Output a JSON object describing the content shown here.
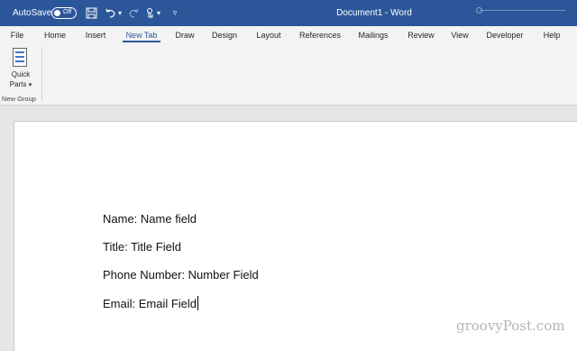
{
  "title_bar": {
    "autosave_label": "AutoSave",
    "autosave_state": "Off",
    "save_icon": "save-icon",
    "undo_icon": "undo-icon",
    "redo_icon": "redo-icon",
    "touch_icon": "touch-mode-icon",
    "customize_icon": "customize-qat-icon",
    "document_title": "Document1 - Word",
    "colors": {
      "background": "#2b579a",
      "text": "#ffffff"
    }
  },
  "tabs": [
    {
      "label": "File"
    },
    {
      "label": "Home"
    },
    {
      "label": "Insert"
    },
    {
      "label": "New Tab"
    },
    {
      "label": "Draw"
    },
    {
      "label": "Design"
    },
    {
      "label": "Layout"
    },
    {
      "label": "References"
    },
    {
      "label": "Mailings"
    },
    {
      "label": "Review"
    },
    {
      "label": "View"
    },
    {
      "label": "Developer"
    },
    {
      "label": "Help"
    }
  ],
  "active_tab": "New Tab",
  "ribbon": {
    "quick_parts": {
      "line1": "Quick",
      "line2": "Parts",
      "icon": "quick-parts-icon",
      "dropdown_icon": "chevron-down-icon"
    },
    "group_label": "New Group"
  },
  "document": {
    "lines": [
      "Name: Name field",
      "Title: Title Field",
      "Phone Number: Number Field",
      "Email: Email Field"
    ]
  },
  "watermark": "groovyPost.com"
}
